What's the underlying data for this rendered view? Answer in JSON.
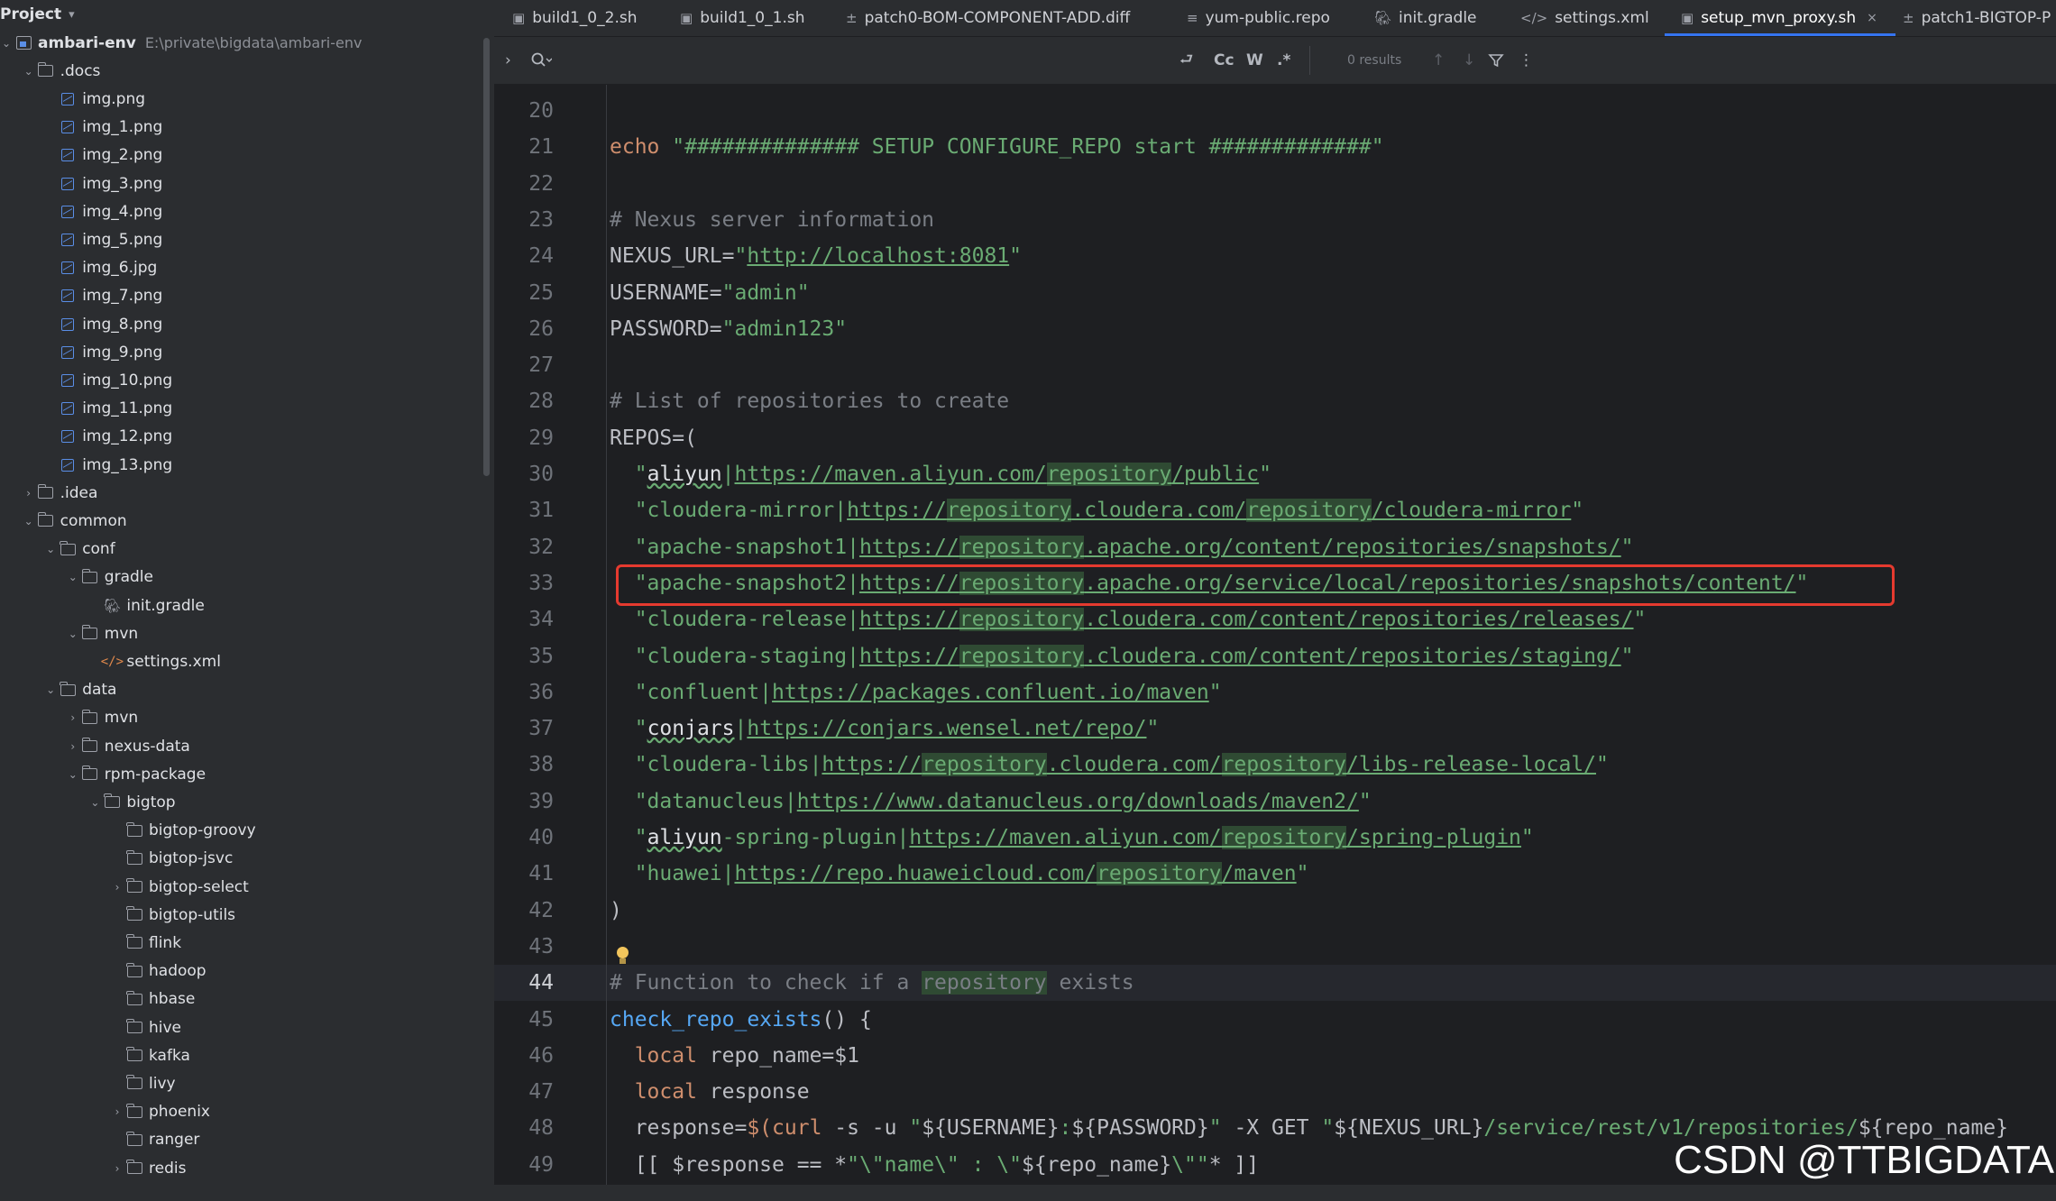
{
  "project_panel": {
    "title": "Project",
    "tree": [
      {
        "label": "ambari-env",
        "sub": "E:\\private\\bigdata\\ambari-env",
        "type": "project",
        "depth": 0,
        "expanded": true,
        "bold": true
      },
      {
        "label": ".docs",
        "type": "folder",
        "depth": 1,
        "expanded": true
      },
      {
        "label": "img.png",
        "type": "image",
        "depth": 2
      },
      {
        "label": "img_1.png",
        "type": "image",
        "depth": 2
      },
      {
        "label": "img_2.png",
        "type": "image",
        "depth": 2
      },
      {
        "label": "img_3.png",
        "type": "image",
        "depth": 2
      },
      {
        "label": "img_4.png",
        "type": "image",
        "depth": 2
      },
      {
        "label": "img_5.png",
        "type": "image",
        "depth": 2
      },
      {
        "label": "img_6.jpg",
        "type": "image",
        "depth": 2
      },
      {
        "label": "img_7.png",
        "type": "image",
        "depth": 2
      },
      {
        "label": "img_8.png",
        "type": "image",
        "depth": 2
      },
      {
        "label": "img_9.png",
        "type": "image",
        "depth": 2
      },
      {
        "label": "img_10.png",
        "type": "image",
        "depth": 2
      },
      {
        "label": "img_11.png",
        "type": "image",
        "depth": 2
      },
      {
        "label": "img_12.png",
        "type": "image",
        "depth": 2
      },
      {
        "label": "img_13.png",
        "type": "image",
        "depth": 2
      },
      {
        "label": ".idea",
        "type": "folder",
        "depth": 1,
        "expanded": false
      },
      {
        "label": "common",
        "type": "folder",
        "depth": 1,
        "expanded": true
      },
      {
        "label": "conf",
        "type": "folder",
        "depth": 2,
        "expanded": true
      },
      {
        "label": "gradle",
        "type": "folder",
        "depth": 3,
        "expanded": true
      },
      {
        "label": "init.gradle",
        "type": "gradle",
        "depth": 4
      },
      {
        "label": "mvn",
        "type": "folder",
        "depth": 3,
        "expanded": true
      },
      {
        "label": "settings.xml",
        "type": "xml",
        "depth": 4
      },
      {
        "label": "data",
        "type": "folder",
        "depth": 2,
        "expanded": true
      },
      {
        "label": "mvn",
        "type": "folder",
        "depth": 3,
        "expanded": false
      },
      {
        "label": "nexus-data",
        "type": "folder",
        "depth": 3,
        "expanded": false
      },
      {
        "label": "rpm-package",
        "type": "folder",
        "depth": 3,
        "expanded": true
      },
      {
        "label": "bigtop",
        "type": "folder",
        "depth": 4,
        "expanded": true
      },
      {
        "label": "bigtop-groovy",
        "type": "folder",
        "depth": 5
      },
      {
        "label": "bigtop-jsvc",
        "type": "folder",
        "depth": 5
      },
      {
        "label": "bigtop-select",
        "type": "folder",
        "depth": 5,
        "expanded": false
      },
      {
        "label": "bigtop-utils",
        "type": "folder",
        "depth": 5
      },
      {
        "label": "flink",
        "type": "folder",
        "depth": 5
      },
      {
        "label": "hadoop",
        "type": "folder",
        "depth": 5
      },
      {
        "label": "hbase",
        "type": "folder",
        "depth": 5
      },
      {
        "label": "hive",
        "type": "folder",
        "depth": 5
      },
      {
        "label": "kafka",
        "type": "folder",
        "depth": 5
      },
      {
        "label": "livy",
        "type": "folder",
        "depth": 5
      },
      {
        "label": "phoenix",
        "type": "folder",
        "depth": 5,
        "expanded": false
      },
      {
        "label": "ranger",
        "type": "folder",
        "depth": 5
      },
      {
        "label": "redis",
        "type": "folder",
        "depth": 5,
        "expanded": false
      }
    ]
  },
  "tabs": [
    {
      "label": "build1_0_2.sh",
      "icon": "shell-icon"
    },
    {
      "label": "build1_0_1.sh",
      "icon": "shell-icon"
    },
    {
      "label": "patch0-BOM-COMPONENT-ADD.diff",
      "icon": "diff-icon"
    },
    {
      "label": "yum-public.repo",
      "icon": "text-file-icon"
    },
    {
      "label": "init.gradle",
      "icon": "gradle-icon"
    },
    {
      "label": "settings.xml",
      "icon": "xml-icon"
    },
    {
      "label": "setup_mvn_proxy.sh",
      "icon": "shell-icon",
      "active": true
    },
    {
      "label": "patch1-BIGTOP-P",
      "icon": "diff-icon"
    }
  ],
  "find_bar": {
    "search_value": "",
    "results": "0 results",
    "toggles": {
      "wrap": "⮐",
      "case": "Cc",
      "word": "W",
      "regex": ".*"
    }
  },
  "editor": {
    "current_line": 44,
    "annotated_line": 33,
    "annotation_color": "#e53a2f",
    "lines": [
      {
        "n": "20",
        "tokens": []
      },
      {
        "n": "21",
        "tokens": [
          [
            "kw",
            "echo"
          ],
          [
            "plain",
            " "
          ],
          [
            "str",
            "\"############## SETUP CONFIGURE_REPO start #############\""
          ]
        ]
      },
      {
        "n": "22",
        "tokens": []
      },
      {
        "n": "23",
        "tokens": [
          [
            "cm",
            "# Nexus server information"
          ]
        ]
      },
      {
        "n": "24",
        "tokens": [
          [
            "plain",
            "NEXUS_URL="
          ],
          [
            "str",
            "\""
          ],
          [
            "url",
            "http://localhost:8081"
          ],
          [
            "str",
            "\""
          ]
        ]
      },
      {
        "n": "25",
        "tokens": [
          [
            "plain",
            "USERNAME="
          ],
          [
            "str",
            "\"admin\""
          ]
        ]
      },
      {
        "n": "26",
        "tokens": [
          [
            "plain",
            "PASSWORD="
          ],
          [
            "str",
            "\"admin123\""
          ]
        ]
      },
      {
        "n": "27",
        "tokens": []
      },
      {
        "n": "28",
        "tokens": [
          [
            "cm",
            "# List of repositories to create"
          ]
        ]
      },
      {
        "n": "29",
        "tokens": [
          [
            "plain",
            "REPOS=("
          ]
        ]
      },
      {
        "n": "30",
        "tokens": [
          [
            "plain",
            "  "
          ],
          [
            "str",
            "\""
          ],
          [
            "typo",
            "aliyun"
          ],
          [
            "str",
            "|"
          ],
          [
            "url",
            "https://maven.aliyun.com/"
          ],
          [
            "url hl",
            "repository"
          ],
          [
            "url",
            "/public"
          ],
          [
            "str",
            "\""
          ]
        ]
      },
      {
        "n": "31",
        "tokens": [
          [
            "plain",
            "  "
          ],
          [
            "str",
            "\"cloudera-mirror|"
          ],
          [
            "url",
            "https://"
          ],
          [
            "url hl",
            "repository"
          ],
          [
            "url",
            ".cloudera.com/"
          ],
          [
            "url hl",
            "repository"
          ],
          [
            "url",
            "/cloudera-mirror"
          ],
          [
            "str",
            "\""
          ]
        ]
      },
      {
        "n": "32",
        "tokens": [
          [
            "plain",
            "  "
          ],
          [
            "str",
            "\"apache-snapshot1|"
          ],
          [
            "url",
            "https://"
          ],
          [
            "url hl",
            "repository"
          ],
          [
            "url",
            ".apache.org/content/repositories/snapshots/"
          ],
          [
            "str",
            "\""
          ]
        ]
      },
      {
        "n": "33",
        "tokens": [
          [
            "plain",
            "  "
          ],
          [
            "str",
            "\"apache-snapshot2|"
          ],
          [
            "url",
            "https://"
          ],
          [
            "url hl",
            "repository"
          ],
          [
            "url",
            ".apache.org/service/local/repositories/snapshots/content/"
          ],
          [
            "str",
            "\""
          ]
        ]
      },
      {
        "n": "34",
        "tokens": [
          [
            "plain",
            "  "
          ],
          [
            "str",
            "\"cloudera-release|"
          ],
          [
            "url",
            "https://"
          ],
          [
            "url hl",
            "repository"
          ],
          [
            "url",
            ".cloudera.com/content/repositories/releases/"
          ],
          [
            "str",
            "\""
          ]
        ]
      },
      {
        "n": "35",
        "tokens": [
          [
            "plain",
            "  "
          ],
          [
            "str",
            "\"cloudera-staging|"
          ],
          [
            "url",
            "https://"
          ],
          [
            "url hl",
            "repository"
          ],
          [
            "url",
            ".cloudera.com/content/repositories/staging/"
          ],
          [
            "str",
            "\""
          ]
        ]
      },
      {
        "n": "36",
        "tokens": [
          [
            "plain",
            "  "
          ],
          [
            "str",
            "\"confluent|"
          ],
          [
            "url",
            "https://packages.confluent.io/maven"
          ],
          [
            "str",
            "\""
          ]
        ]
      },
      {
        "n": "37",
        "tokens": [
          [
            "plain",
            "  "
          ],
          [
            "str",
            "\""
          ],
          [
            "typo",
            "conjars"
          ],
          [
            "str",
            "|"
          ],
          [
            "url",
            "https://conjars.wensel.net/repo/"
          ],
          [
            "str",
            "\""
          ]
        ]
      },
      {
        "n": "38",
        "tokens": [
          [
            "plain",
            "  "
          ],
          [
            "str",
            "\"cloudera-libs|"
          ],
          [
            "url",
            "https://"
          ],
          [
            "url hl",
            "repository"
          ],
          [
            "url",
            ".cloudera.com/"
          ],
          [
            "url hl",
            "repository"
          ],
          [
            "url",
            "/libs-release-local/"
          ],
          [
            "str",
            "\""
          ]
        ]
      },
      {
        "n": "39",
        "tokens": [
          [
            "plain",
            "  "
          ],
          [
            "str",
            "\"datanucleus|"
          ],
          [
            "url",
            "https://www.datanucleus.org/downloads/maven2/"
          ],
          [
            "str",
            "\""
          ]
        ]
      },
      {
        "n": "40",
        "tokens": [
          [
            "plain",
            "  "
          ],
          [
            "str",
            "\""
          ],
          [
            "typo",
            "aliyun"
          ],
          [
            "str",
            "-spring-plugin|"
          ],
          [
            "url",
            "https://maven.aliyun.com/"
          ],
          [
            "url hl",
            "repository"
          ],
          [
            "url",
            "/spring-plugin"
          ],
          [
            "str",
            "\""
          ]
        ]
      },
      {
        "n": "41",
        "tokens": [
          [
            "plain",
            "  "
          ],
          [
            "str",
            "\"huawei|"
          ],
          [
            "url",
            "https://repo.huaweicloud.com/"
          ],
          [
            "url hl",
            "repository"
          ],
          [
            "url",
            "/maven"
          ],
          [
            "str",
            "\""
          ]
        ]
      },
      {
        "n": "42",
        "tokens": [
          [
            "plain",
            ")"
          ]
        ]
      },
      {
        "n": "43",
        "tokens": []
      },
      {
        "n": "44",
        "tokens": [
          [
            "cm",
            "# Function to check if a "
          ],
          [
            "cm hl",
            "repository"
          ],
          [
            "cm",
            " exists"
          ]
        ]
      },
      {
        "n": "45",
        "tokens": [
          [
            "fn",
            "check_repo_exists"
          ],
          [
            "plain",
            "() {"
          ]
        ]
      },
      {
        "n": "46",
        "tokens": [
          [
            "plain",
            "  "
          ],
          [
            "kw",
            "local"
          ],
          [
            "plain",
            " repo_name=$1"
          ]
        ]
      },
      {
        "n": "47",
        "tokens": [
          [
            "plain",
            "  "
          ],
          [
            "kw",
            "local"
          ],
          [
            "plain",
            " response"
          ]
        ]
      },
      {
        "n": "48",
        "tokens": [
          [
            "plain",
            "  response="
          ],
          [
            "kw",
            "$("
          ],
          [
            "kw",
            "curl"
          ],
          [
            "plain",
            " -s -u "
          ],
          [
            "str",
            "\""
          ],
          [
            "plain",
            "${USERNAME}"
          ],
          [
            "str",
            ":"
          ],
          [
            "plain",
            "${PASSWORD}"
          ],
          [
            "str",
            "\""
          ],
          [
            "plain",
            " -X GET "
          ],
          [
            "str",
            "\""
          ],
          [
            "plain",
            "${NEXUS_URL}"
          ],
          [
            "path",
            "/service/rest/v1/repositories/"
          ],
          [
            "plain",
            "${repo_name}"
          ]
        ]
      },
      {
        "n": "49",
        "tokens": [
          [
            "plain",
            "  [[ $response == *"
          ],
          [
            "str",
            "\"\\\"name\\\" : \\\""
          ],
          [
            "plain",
            "${repo_name}"
          ],
          [
            "str",
            "\\\"\""
          ],
          [
            "plain",
            "* ]]"
          ]
        ]
      }
    ]
  },
  "watermark": "CSDN @TTBIGDATA"
}
